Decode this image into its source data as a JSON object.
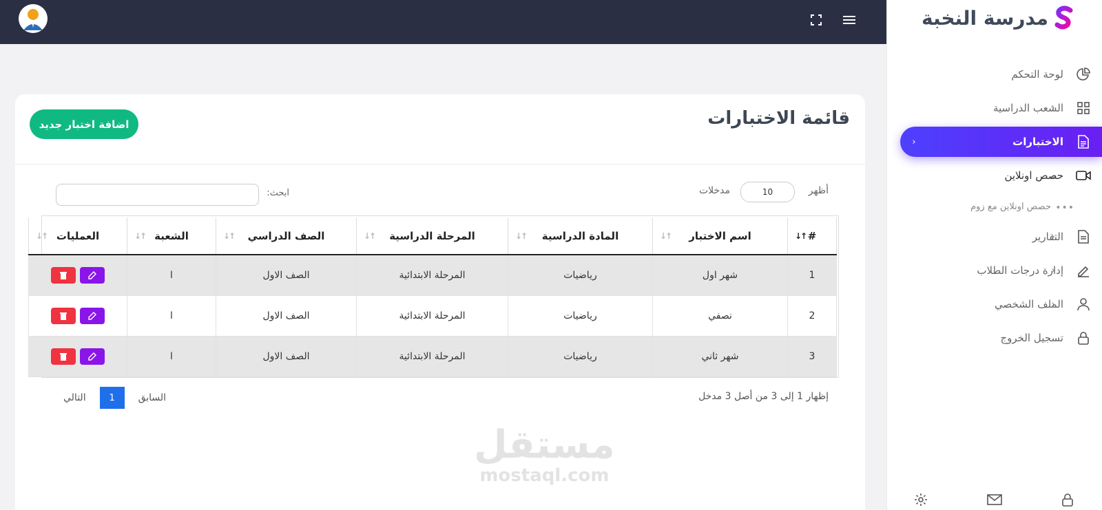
{
  "sidebar": {
    "brand": "مدرسة النخبة",
    "items": [
      {
        "label": "لوحة التحكم",
        "icon": "pie-chart-icon"
      },
      {
        "label": "الشعب الدراسية",
        "icon": "grid-icon"
      },
      {
        "label": "الاختبارات",
        "icon": "document-icon"
      },
      {
        "label": "حصص اونلاين",
        "icon": "video-camera-icon"
      },
      {
        "label": "حصص اونلاين مع زوم",
        "icon": "dots-icon"
      },
      {
        "label": "التقارير",
        "icon": "document-icon"
      },
      {
        "label": "إدارة درجات الطلاب",
        "icon": "pencil-icon"
      },
      {
        "label": "الملف الشخصي",
        "icon": "user-icon"
      },
      {
        "label": "تسجيل الخروج",
        "icon": "lock-icon"
      }
    ]
  },
  "colors": {
    "topbar": "#2a2f44",
    "active_gradient_start": "#4d40ff",
    "active_gradient_end": "#6a1ff2",
    "add_button": "#10b981",
    "edit_button": "#8a15e8",
    "delete_button": "#ef3340",
    "page_active": "#1f6feb"
  },
  "page": {
    "title": "قائمة الاختبارات",
    "add_button": "اضافة اختبار جديد"
  },
  "controls": {
    "show_label": "أظهر",
    "page_length": "10",
    "entries_label": "مدخلات",
    "search_label": "ابحث:",
    "search_value": ""
  },
  "table": {
    "headers": [
      "#",
      "اسم الاختبار",
      "المادة الدراسية",
      "المرحلة الدراسية",
      "الصف الدراسي",
      "الشعبة",
      "العمليات"
    ],
    "rows": [
      [
        "1",
        "شهر اول",
        "رياضيات",
        "المرحلة الابتدائية",
        "الصف الاول",
        "ا"
      ],
      [
        "2",
        "نصفي",
        "رياضيات",
        "المرحلة الابتدائية",
        "الصف الاول",
        "ا"
      ],
      [
        "3",
        "شهر ثاني",
        "رياضيات",
        "المرحلة الابتدائية",
        "الصف الاول",
        "ا"
      ]
    ]
  },
  "footer": {
    "info": "إظهار 1 إلى 3 من أصل 3 مدخل",
    "prev": "السابق",
    "page": "1",
    "next": "التالي"
  },
  "watermark": {
    "arabic": "مستقل",
    "latin": "mostaql.com"
  }
}
